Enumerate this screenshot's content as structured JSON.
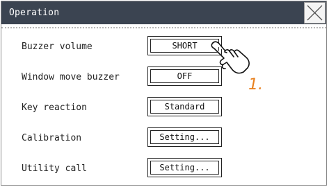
{
  "window": {
    "title": "Operation"
  },
  "settings": [
    {
      "label": "Buzzer volume",
      "value": "SHORT"
    },
    {
      "label": "Window move buzzer",
      "value": "OFF"
    },
    {
      "label": "Key reaction",
      "value": "Standard"
    },
    {
      "label": "Calibration",
      "value": "Setting..."
    },
    {
      "label": "Utility call",
      "value": "Setting..."
    }
  ],
  "annotation": {
    "step_label": "1.",
    "color": "#e8801e"
  },
  "icons": {
    "close": "close-icon",
    "pointer": "hand-pointer-icon"
  },
  "colors": {
    "titlebar": "#3b4451"
  }
}
